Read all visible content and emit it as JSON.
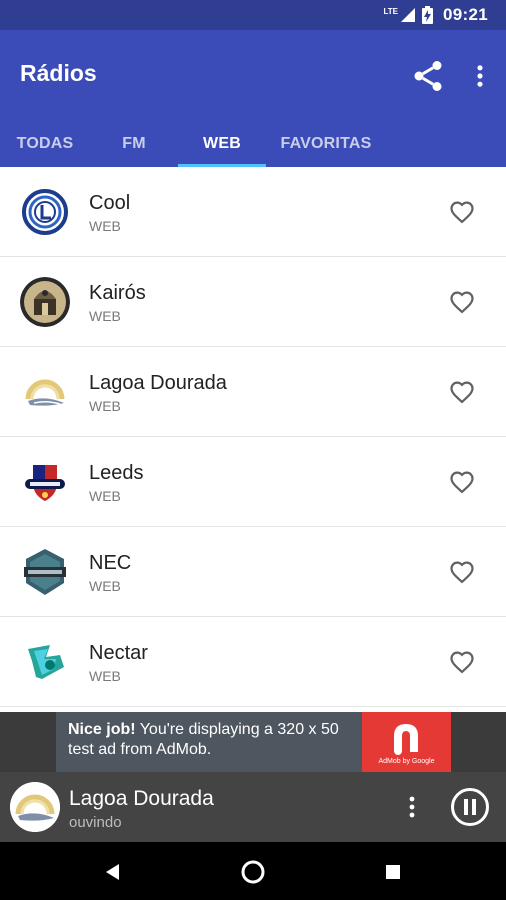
{
  "status_bar": {
    "time": "09:21",
    "network": "LTE",
    "icons": [
      "lte-signal-icon",
      "battery-charging-icon"
    ]
  },
  "toolbar": {
    "title": "Rádios",
    "share_icon": "share-icon",
    "more_icon": "more-vert-icon"
  },
  "tabs": [
    {
      "label": "TODAS",
      "active": false
    },
    {
      "label": "FM",
      "active": false
    },
    {
      "label": "WEB",
      "active": true
    },
    {
      "label": "FAVORITAS",
      "active": false
    }
  ],
  "stations": [
    {
      "name": "Cool",
      "type": "WEB",
      "logo": "cool-logo-icon",
      "favorite_icon": "heart-outline-icon"
    },
    {
      "name": "Kairós",
      "type": "WEB",
      "logo": "kairos-logo-icon",
      "favorite_icon": "heart-outline-icon"
    },
    {
      "name": "Lagoa Dourada",
      "type": "WEB",
      "logo": "lagoa-dourada-logo-icon",
      "favorite_icon": "heart-outline-icon"
    },
    {
      "name": "Leeds",
      "type": "WEB",
      "logo": "leeds-logo-icon",
      "favorite_icon": "heart-outline-icon"
    },
    {
      "name": "NEC",
      "type": "WEB",
      "logo": "nec-logo-icon",
      "favorite_icon": "heart-outline-icon"
    },
    {
      "name": "Nectar",
      "type": "WEB",
      "logo": "nectar-logo-icon",
      "favorite_icon": "heart-outline-icon"
    }
  ],
  "ad": {
    "bold": "Nice job!",
    "text": " You're displaying a 320 x 50 test ad from AdMob.",
    "caption": "AdMob by Google"
  },
  "player": {
    "title": "Lagoa Dourada",
    "status": "ouvindo",
    "more_icon": "more-vert-icon",
    "pause_icon": "pause-circle-icon"
  },
  "nav_bar": {
    "icons": [
      "back-icon",
      "home-icon",
      "recents-icon"
    ]
  },
  "colors": {
    "primary": "#3b4cb8",
    "status_bar": "#2f3e92",
    "tab_indicator": "#4fc3f7",
    "ad_red": "#e53935"
  }
}
